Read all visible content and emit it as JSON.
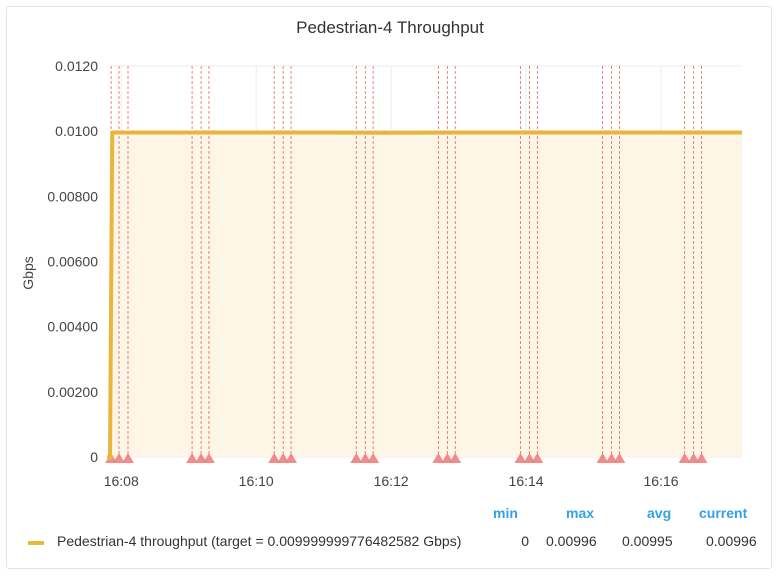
{
  "panel": {
    "title": "Pedestrian-4 Throughput"
  },
  "legend": {
    "headers": {
      "min": "min",
      "max": "max",
      "avg": "avg",
      "current": "current"
    },
    "series_label": "Pedestrian-4 throughput (target = 0.009999999776482582 Gbps)",
    "min": "0",
    "max": "0.00996",
    "avg": "0.00995",
    "current": "0.00996"
  },
  "chart_data": {
    "type": "area",
    "title": "Pedestrian-4 Throughput",
    "ylabel": "Gbps",
    "xlabel": "",
    "ylim": [
      0,
      0.012
    ],
    "xlim": [
      "16:07:50",
      "16:17:12"
    ],
    "yticks": [
      "0",
      "0.00200",
      "0.00400",
      "0.00600",
      "0.00800",
      "0.0100",
      "0.0120"
    ],
    "ytick_values": [
      0,
      0.002,
      0.004,
      0.006,
      0.008,
      0.01,
      0.012
    ],
    "xticks": [
      "16:08",
      "16:10",
      "16:12",
      "16:14",
      "16:16"
    ],
    "grid": true,
    "legend_position": "bottom",
    "series": [
      {
        "name": "Pedestrian-4 throughput (target = 0.009999999776482582 Gbps)",
        "color": "#e9b53d",
        "x": [
          "16:07:50",
          "16:07:52",
          "16:09",
          "16:10",
          "16:11",
          "16:12",
          "16:13",
          "16:14",
          "16:15",
          "16:16",
          "16:17:12"
        ],
        "y": [
          0,
          0.00996,
          0.00996,
          0.00996,
          0.00996,
          0.00995,
          0.00996,
          0.00996,
          0.00996,
          0.00996,
          0.00996
        ]
      }
    ],
    "target_line": 0.009999999776482582,
    "annotations": {
      "color": "#e24d42",
      "times": [
        "16:07:51",
        "16:07:58",
        "16:08:06",
        "16:09:03",
        "16:09:11",
        "16:09:18",
        "16:10:16",
        "16:10:24",
        "16:10:31",
        "16:11:29",
        "16:11:37",
        "16:11:44",
        "16:12:42",
        "16:12:50",
        "16:12:57",
        "16:13:55",
        "16:14:03",
        "16:14:10",
        "16:15:08",
        "16:15:16",
        "16:15:23",
        "16:16:21",
        "16:16:29",
        "16:16:36"
      ]
    }
  }
}
